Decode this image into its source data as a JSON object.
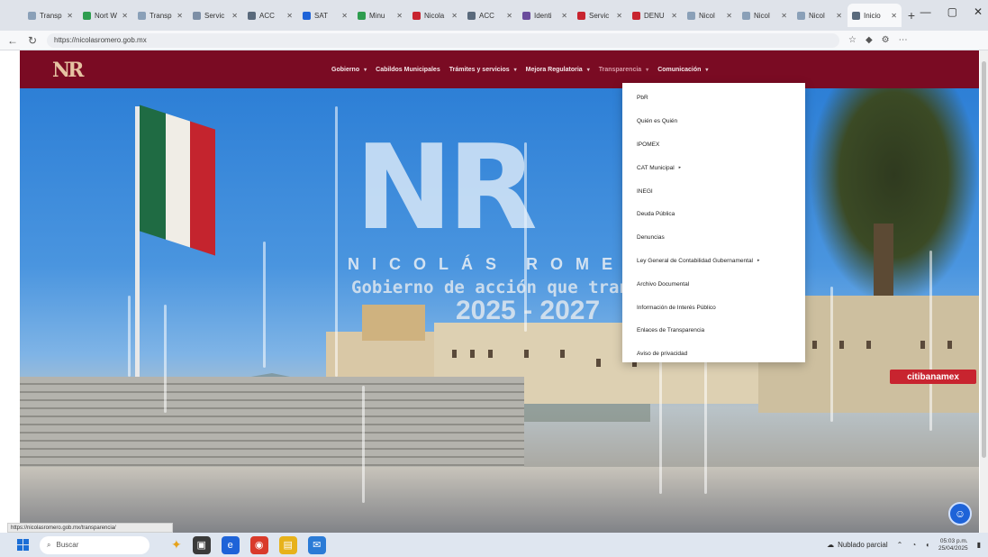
{
  "browser": {
    "tabs": [
      {
        "title": "Transp",
        "icon_color": "#8aa0b8"
      },
      {
        "title": "Nort W",
        "icon_color": "#2e9d4f"
      },
      {
        "title": "Transp",
        "icon_color": "#8aa0b8"
      },
      {
        "title": "Servic",
        "icon_color": "#7d8fa6"
      },
      {
        "title": "ACC",
        "icon_color": "#5a6a7c"
      },
      {
        "title": "SAT",
        "icon_color": "#1e63d8"
      },
      {
        "title": "Minu",
        "icon_color": "#2e9d4f"
      },
      {
        "title": "Nicola",
        "icon_color": "#c8242f"
      },
      {
        "title": "ACC",
        "icon_color": "#5a6a7c"
      },
      {
        "title": "Identi",
        "icon_color": "#6a4c9c"
      },
      {
        "title": "Servic",
        "icon_color": "#c8242f"
      },
      {
        "title": "DENU",
        "icon_color": "#c8242f"
      },
      {
        "title": "Nicol",
        "icon_color": "#8aa0b8"
      },
      {
        "title": "Nicol",
        "icon_color": "#8aa0b8"
      },
      {
        "title": "Nicol",
        "icon_color": "#8aa0b8"
      },
      {
        "title": "Inicio",
        "icon_color": "#5a6a7c",
        "active": true
      }
    ],
    "url": "https://nicolasromero.gob.mx"
  },
  "site": {
    "logo_text": "NR",
    "nav": [
      {
        "label": "Gobierno",
        "caret": true
      },
      {
        "label": "Cabildos Municipales",
        "caret": false
      },
      {
        "label": "Trámites y servicios",
        "caret": true
      },
      {
        "label": "Mejora Regulatoria",
        "caret": true
      },
      {
        "label": "Transparencia",
        "caret": true,
        "highlighted": true
      },
      {
        "label": "Comunicación",
        "caret": true
      }
    ],
    "dropdown": [
      {
        "label": "PbR",
        "caret": false
      },
      {
        "label": "Quién es Quién",
        "caret": false
      },
      {
        "label": "IPOMEX",
        "caret": false
      },
      {
        "label": "CAT Municipal",
        "caret": true
      },
      {
        "label": "INEGI",
        "caret": false
      },
      {
        "label": "Deuda Pública",
        "caret": false
      },
      {
        "label": "Denuncias",
        "caret": false
      },
      {
        "label": "Ley General de Contabilidad Gubernamental",
        "caret": true
      },
      {
        "label": "Archivo Documental",
        "caret": false
      },
      {
        "label": "Información de Interés Público",
        "caret": false
      },
      {
        "label": "Enlaces de Transparencia",
        "caret": false
      },
      {
        "label": "Aviso de privacidad",
        "caret": false
      }
    ],
    "hero": {
      "logo": "NR",
      "name": "NICOLÁS ROMERO",
      "slogan": "Gobierno de acción que transforma",
      "years": "2025 - 2027"
    },
    "bank_sign": "citibanamex",
    "help_icon": "accessibility-icon"
  },
  "status_url": "https://nicolasromero.gob.mx/transparencia/",
  "taskbar": {
    "search_placeholder": "Buscar",
    "weather": "Nublado parcial",
    "time": "05:03 p.m.",
    "date": "25/04/2025"
  }
}
